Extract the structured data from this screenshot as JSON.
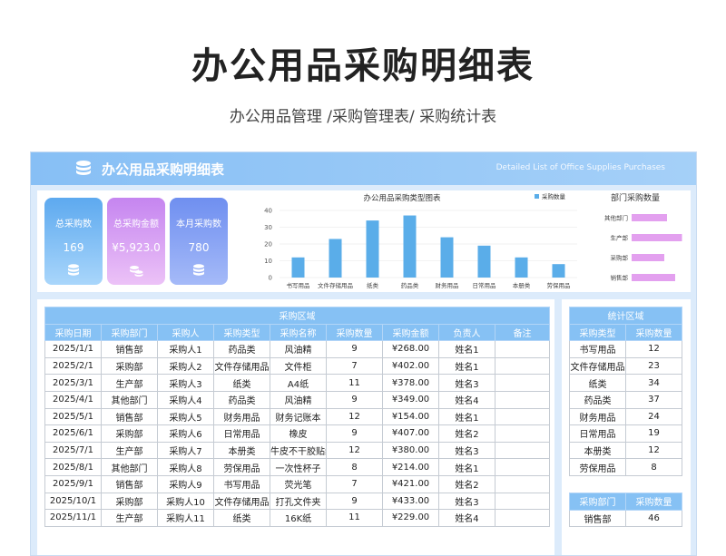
{
  "header": {
    "title": "办公用品采购明细表",
    "subtitle": "办公用品管理 /采购管理表/ 采购统计表"
  },
  "banner": {
    "title": "办公用品采购明细表",
    "subtitle_en": "Detailed List of Office Supplies Purchases",
    "icon": "database-icon"
  },
  "kpis": [
    {
      "label": "总采购数",
      "value": "169",
      "icon": "database-icon"
    },
    {
      "label": "总采购金额",
      "value": "¥5,923.0",
      "icon": "coins-icon"
    },
    {
      "label": "本月采购数",
      "value": "780",
      "icon": "database-icon"
    }
  ],
  "chart_data": [
    {
      "type": "bar",
      "title": "办公用品采购类型图表",
      "legend": "采购数量",
      "legend_position": "top-right",
      "categories": [
        "书写用品",
        "文件存储用品",
        "纸类",
        "药品类",
        "财务用品",
        "日常用品",
        "本册类",
        "劳保用品"
      ],
      "series": [
        {
          "name": "采购数量",
          "values": [
            12,
            23,
            34,
            37,
            24,
            19,
            12,
            8
          ]
        }
      ],
      "ylim": [
        0,
        40
      ],
      "yticks": [
        "0",
        "10",
        "20",
        "30",
        "40"
      ],
      "color": "#5aade9"
    },
    {
      "type": "bar",
      "orientation": "horizontal",
      "title": "部门采购数量",
      "categories": [
        "其他部门",
        "生产部",
        "采购部",
        "销售部"
      ],
      "values": [
        26,
        37,
        24,
        32
      ],
      "color": "#e3a0ef"
    }
  ],
  "main_table": {
    "area_title": "采购区域",
    "columns": [
      "采购日期",
      "采购部门",
      "采购人",
      "采购类型",
      "采购名称",
      "采购数量",
      "采购金额",
      "负责人",
      "备注"
    ],
    "rows": [
      [
        "2025/1/1",
        "销售部",
        "采购人1",
        "药品类",
        "风油精",
        "9",
        "¥268.00",
        "姓名1",
        ""
      ],
      [
        "2025/2/1",
        "采购部",
        "采购人2",
        "文件存储用品",
        "文件柜",
        "7",
        "¥402.00",
        "姓名1",
        ""
      ],
      [
        "2025/3/1",
        "生产部",
        "采购人3",
        "纸类",
        "A4纸",
        "11",
        "¥378.00",
        "姓名3",
        ""
      ],
      [
        "2025/4/1",
        "其他部门",
        "采购人4",
        "药品类",
        "风油精",
        "9",
        "¥349.00",
        "姓名4",
        ""
      ],
      [
        "2025/5/1",
        "销售部",
        "采购人5",
        "财务用品",
        "财务记账本",
        "12",
        "¥154.00",
        "姓名1",
        ""
      ],
      [
        "2025/6/1",
        "采购部",
        "采购人6",
        "日常用品",
        "橡皮",
        "9",
        "¥407.00",
        "姓名2",
        ""
      ],
      [
        "2025/7/1",
        "生产部",
        "采购人7",
        "本册类",
        "牛皮不干胶贴纸",
        "12",
        "¥380.00",
        "姓名3",
        ""
      ],
      [
        "2025/8/1",
        "其他部门",
        "采购人8",
        "劳保用品",
        "一次性杯子",
        "8",
        "¥214.00",
        "姓名1",
        ""
      ],
      [
        "2025/9/1",
        "销售部",
        "采购人9",
        "书写用品",
        "荧光笔",
        "7",
        "¥421.00",
        "姓名2",
        ""
      ],
      [
        "2025/10/1",
        "采购部",
        "采购人10",
        "文件存储用品",
        "打孔文件夹",
        "9",
        "¥433.00",
        "姓名3",
        ""
      ],
      [
        "2025/11/1",
        "生产部",
        "采购人11",
        "纸类",
        "16K纸",
        "11",
        "¥229.00",
        "姓名4",
        ""
      ]
    ]
  },
  "stats_table": {
    "area_title": "统计区域",
    "columns": [
      "采购类型",
      "采购数量"
    ],
    "rows": [
      [
        "书写用品",
        "12"
      ],
      [
        "文件存储用品",
        "23"
      ],
      [
        "纸类",
        "34"
      ],
      [
        "药品类",
        "37"
      ],
      [
        "财务用品",
        "24"
      ],
      [
        "日常用品",
        "19"
      ],
      [
        "本册类",
        "12"
      ],
      [
        "劳保用品",
        "8"
      ]
    ]
  },
  "dept_table": {
    "columns": [
      "采购部门",
      "采购数量"
    ],
    "rows": [
      [
        "销售部",
        "46"
      ]
    ]
  }
}
